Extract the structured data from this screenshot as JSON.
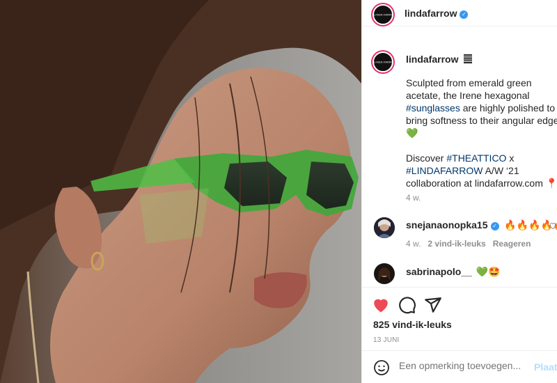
{
  "header": {
    "username": "lindafarrow",
    "avatar_text": "LINDA FARROW",
    "verified": true
  },
  "caption": {
    "username": "lindafarrow",
    "flag_icon": "barcode-flag-icon",
    "text_1": "Sculpted from emerald green acetate, the Irene hexagonal ",
    "tag_1": "#sunglasses",
    "text_2": " are highly polished to bring softness to their angular edges ",
    "emoji_1": "💚",
    "text_3": "Discover ",
    "tag_2": "#THEATTICO",
    "text_4": " x ",
    "tag_3": "#LINDAFARROW",
    "text_5": " A/W ‘21 collaboration at lindafarrow.com ",
    "emoji_2": "📍",
    "time": "4 w."
  },
  "comments": [
    {
      "username": "snejanaonopka15",
      "verified": true,
      "text": "🔥🔥🔥🔥🔥",
      "time": "4 w.",
      "likes": "2 vind-ik-leuks",
      "reply": "Reageren"
    },
    {
      "username": "sabrinapolo__",
      "verified": false,
      "text": "💚🤩"
    }
  ],
  "actions": {
    "like_count": "825 vind-ik-leuks",
    "date": "13 JUNI",
    "comment_placeholder": "Een opmerking toevoegen...",
    "post_label": "Plaatsen",
    "liked_color": "#ed4956"
  }
}
